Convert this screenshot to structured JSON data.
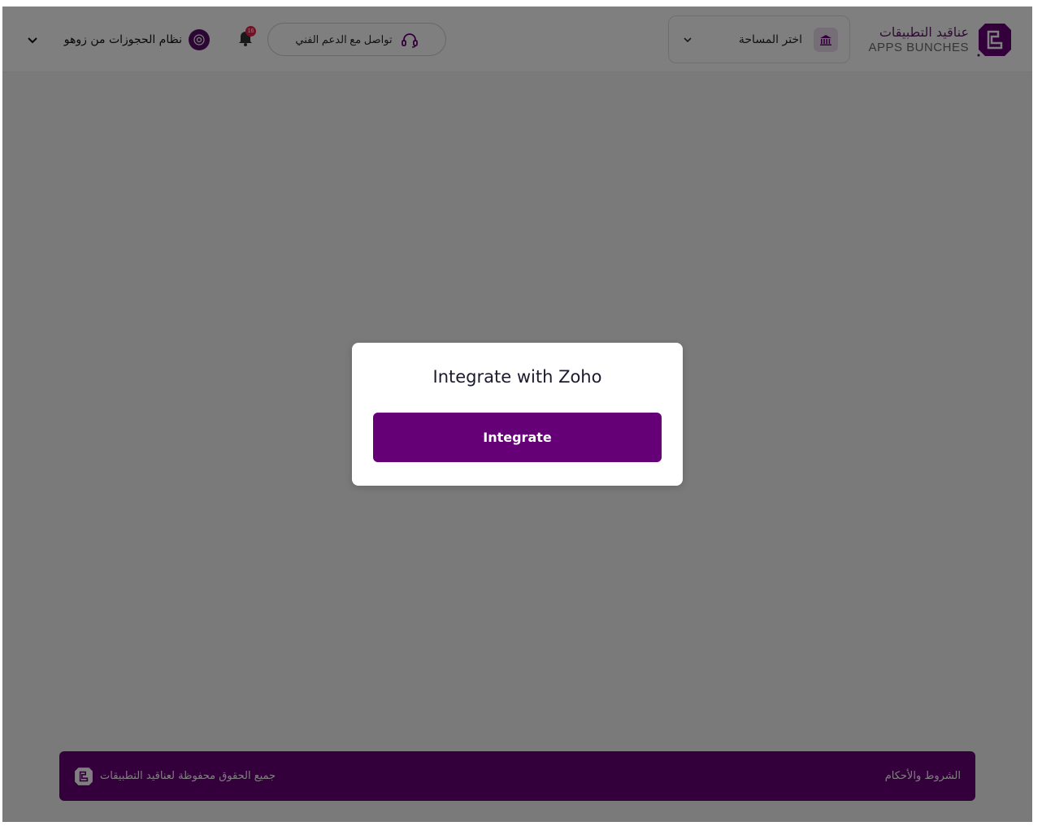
{
  "header": {
    "logo": {
      "arabic": "عناقيد التطبيقات",
      "english": "APPS BUNCHES"
    },
    "space_select": {
      "label": "اختر المساحة",
      "icon": "bank-icon"
    },
    "support_button": {
      "label": "تواصل مع الدعم الفني",
      "icon": "headset-icon"
    },
    "notifications": {
      "count": "16",
      "icon": "bell-icon"
    },
    "account": {
      "name": "نظام الحجوزات من زوهو",
      "icon": "chevron-down-icon"
    }
  },
  "modal": {
    "title": "Integrate with Zoho",
    "button_label": "Integrate"
  },
  "footer": {
    "copyright": "جميع الحقوق محفوظة لعناقيد التطبيقات",
    "terms": "الشروط والأحكام"
  },
  "colors": {
    "brand": "#660076",
    "overlay": "rgba(0,0,0,0.5)",
    "badge": "#e0264b"
  }
}
